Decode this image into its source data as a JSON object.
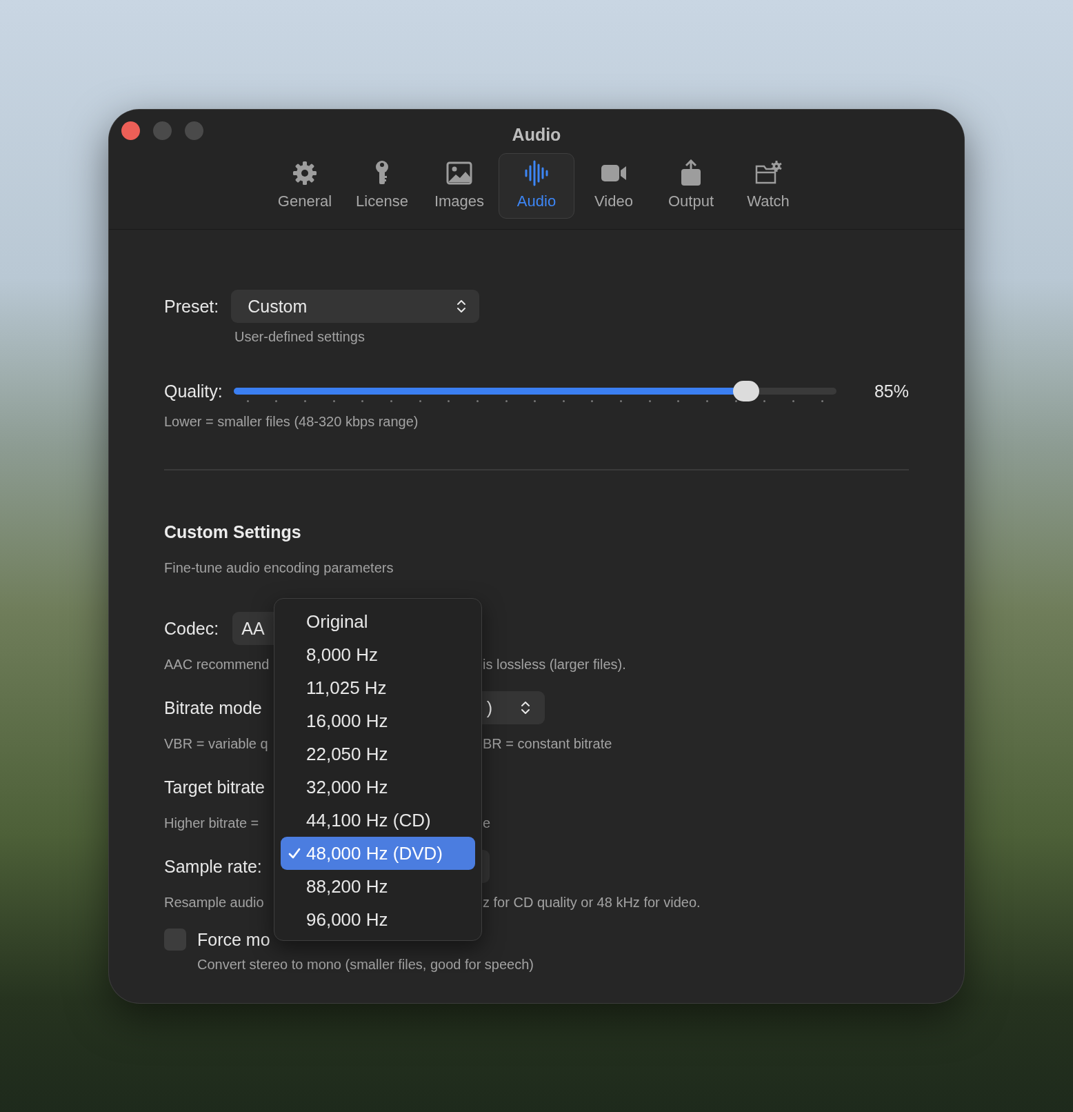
{
  "window": {
    "title": "Audio"
  },
  "tabs": [
    {
      "label": "General",
      "selected": false
    },
    {
      "label": "License",
      "selected": false
    },
    {
      "label": "Images",
      "selected": false
    },
    {
      "label": "Audio",
      "selected": true
    },
    {
      "label": "Video",
      "selected": false
    },
    {
      "label": "Output",
      "selected": false
    },
    {
      "label": "Watch",
      "selected": false
    }
  ],
  "preset": {
    "label": "Preset:",
    "value": "Custom",
    "caption": "User-defined settings"
  },
  "quality": {
    "label": "Quality:",
    "level": 0.85,
    "reading": "85%",
    "caption": "Lower = smaller files (48-320 kbps range)"
  },
  "custom_settings": {
    "heading": "Custom Settings",
    "subtitle": "Fine-tune audio encoding parameters"
  },
  "rows": [
    {
      "kind": "popup_start",
      "label": "Codec:",
      "value": "AA",
      "caption_left": "AAC recommend",
      "caption_right": "is lossless (larger files)."
    },
    {
      "kind": "popup_end",
      "label": "Bitrate mode",
      "value": ")",
      "caption_left": "VBR = variable q",
      "caption_right": "BR = constant bitrate"
    },
    {
      "kind": "plain",
      "label": "Target bitrate",
      "caption_left": "Higher bitrate = ",
      "caption_right": "e"
    },
    {
      "kind": "popup_hidden",
      "label": "Sample rate:",
      "caption_left": "Resample audio",
      "caption_right": "z for CD quality or 48 kHz for video."
    }
  ],
  "force_mono": {
    "label": "Force mo",
    "checked": false,
    "caption": "Convert stereo to mono (smaller files, good for speech)"
  },
  "menu": {
    "items": [
      {
        "label": "Original",
        "selected": false
      },
      {
        "label": "8,000 Hz",
        "selected": false
      },
      {
        "label": "11,025 Hz",
        "selected": false
      },
      {
        "label": "16,000 Hz",
        "selected": false
      },
      {
        "label": "22,050 Hz",
        "selected": false
      },
      {
        "label": "32,000 Hz",
        "selected": false
      },
      {
        "label": "44,100 Hz (CD)",
        "selected": false
      },
      {
        "label": "48,000 Hz (DVD)",
        "selected": true
      },
      {
        "label": "88,200 Hz",
        "selected": false
      },
      {
        "label": "96,000 Hz",
        "selected": false
      }
    ]
  }
}
